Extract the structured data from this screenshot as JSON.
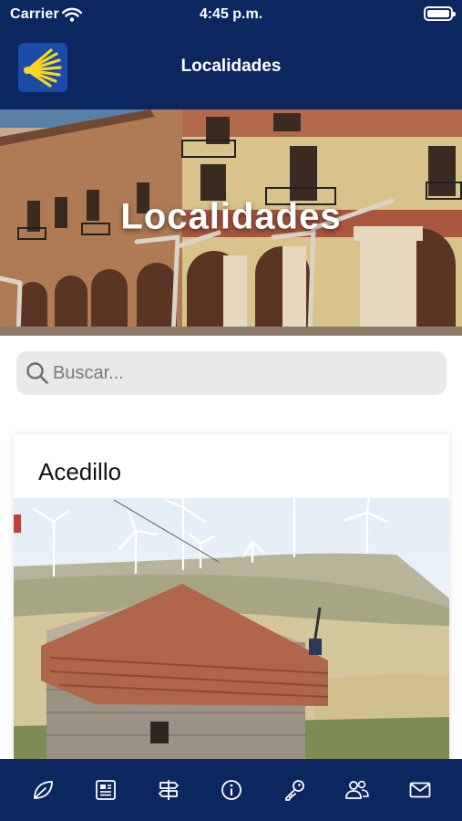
{
  "status_bar": {
    "carrier": "Carrier",
    "time": "4:45 p.m."
  },
  "header": {
    "title": "Localidades",
    "logo_icon": "scallop-shell-icon"
  },
  "hero": {
    "title": "Localidades"
  },
  "search": {
    "placeholder": "Buscar...",
    "value": ""
  },
  "list": {
    "items": [
      {
        "title": "Acedillo"
      }
    ]
  },
  "tab_bar": {
    "items": [
      {
        "icon": "leaf-icon"
      },
      {
        "icon": "newspaper-icon"
      },
      {
        "icon": "signpost-icon"
      },
      {
        "icon": "info-icon"
      },
      {
        "icon": "key-icon"
      },
      {
        "icon": "people-icon"
      },
      {
        "icon": "mail-icon"
      }
    ]
  },
  "colors": {
    "brand_navy": "#0c2660",
    "logo_blue": "#1b4ba8",
    "logo_yellow": "#f5d623"
  }
}
